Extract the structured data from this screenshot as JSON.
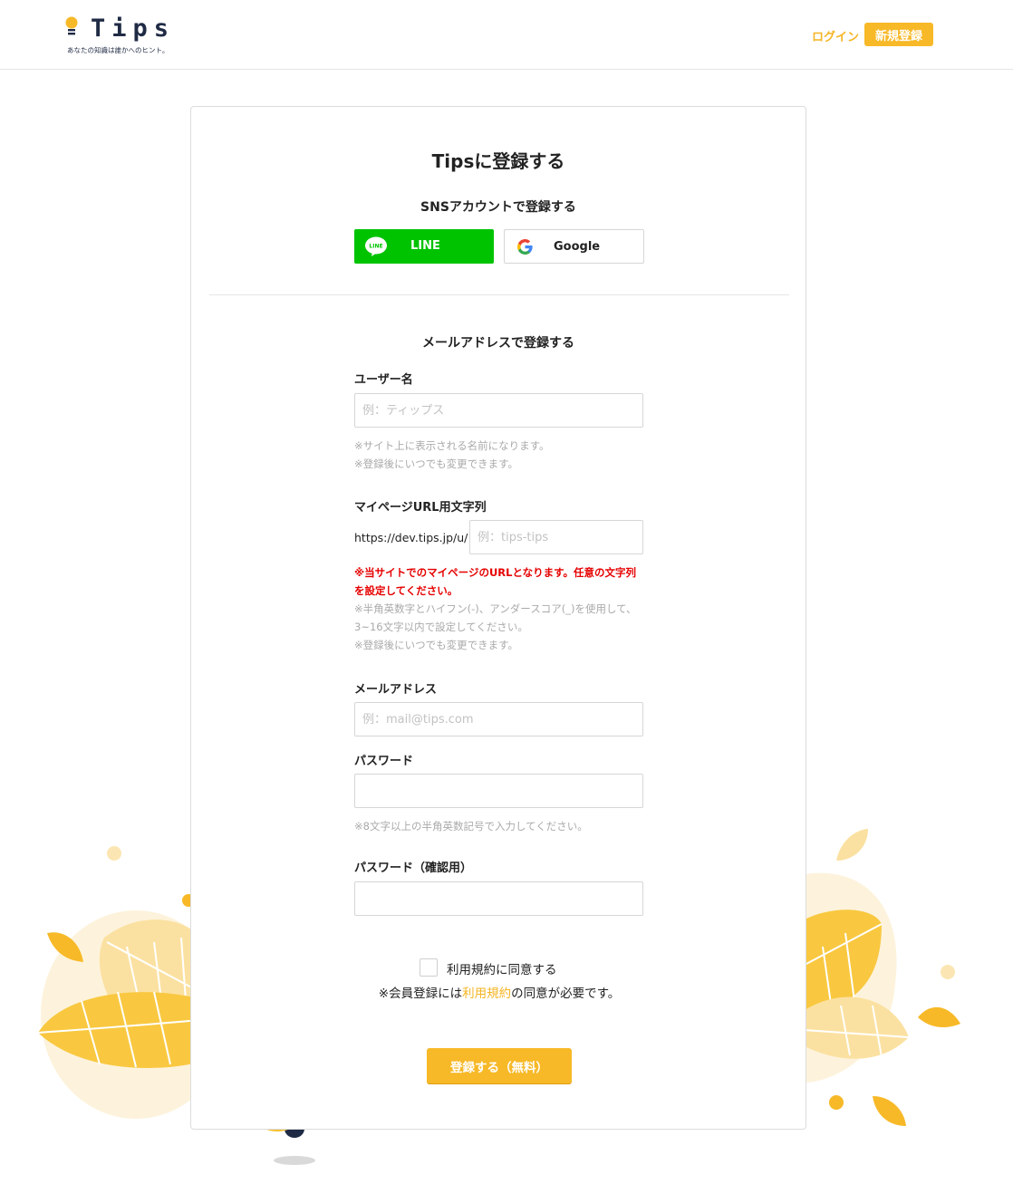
{
  "header": {
    "logo_text": "Tips",
    "tagline": "あなたの知識は誰かへのヒント。",
    "login_label": "ログイン",
    "signup_label": "新規登録"
  },
  "card": {
    "title": "Tipsに登録する",
    "sns_heading": "SNSアカウントで登録する",
    "line_label": "LINE",
    "line_icon_text": "LINE",
    "google_label": "Google",
    "mail_heading": "メールアドレスで登録する"
  },
  "form": {
    "username": {
      "label": "ユーザー名",
      "placeholder": "例：ティップス",
      "notes": [
        "※サイト上に表示される名前になります。",
        "※登録後にいつでも変更できます。"
      ]
    },
    "mypage_url": {
      "label": "マイページURL用文字列",
      "prefix": "https://dev.tips.jp/u/",
      "placeholder": "例：tips-tips",
      "warning": "※当サイトでのマイページのURLとなります。任意の文字列を設定してください。",
      "notes": [
        "※半角英数字とハイフン(-)、アンダースコア(_)を使用して、3~16文字以内で設定してください。",
        "※登録後にいつでも変更できます。"
      ]
    },
    "email": {
      "label": "メールアドレス",
      "placeholder": "例：mail@tips.com"
    },
    "password": {
      "label": "パスワード",
      "placeholder": "",
      "note": "※8文字以上の半角英数記号で入力してください。"
    },
    "password_confirm": {
      "label": "パスワード（確認用）",
      "placeholder": ""
    },
    "agree_label": "利用規約に同意する",
    "agree_note_prefix": "※会員登録には",
    "terms_link": "利用規約",
    "agree_note_suffix": "の同意が必要です。",
    "submit_label": "登録する（無料）"
  },
  "colors": {
    "accent": "#f7b928",
    "line_green": "#00c300",
    "warning_red": "#e60000"
  }
}
